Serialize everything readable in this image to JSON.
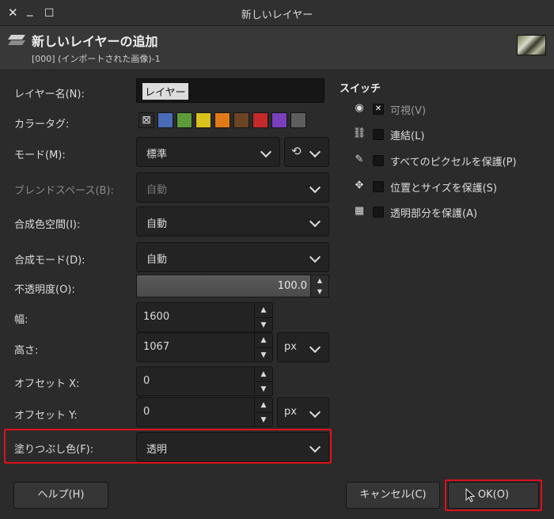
{
  "window": {
    "title": "新しいレイヤー",
    "close_glyph": "✕",
    "minimize_glyph": "_",
    "maximize_glyph": "□"
  },
  "header": {
    "title": "新しいレイヤーの追加",
    "subtitle": "[000] (インポートされた画像)-1",
    "icon": "new-layer-icon",
    "thumbnail": "image-thumbnail"
  },
  "form": {
    "layer_name": {
      "label": "レイヤー名(N):",
      "value": "レイヤー"
    },
    "color_tag": {
      "label": "カラータグ:",
      "none_glyph": "⊠",
      "colors": [
        "#4a6bb5",
        "#5d9a3a",
        "#d8c21c",
        "#e07a18",
        "#6b4424",
        "#c52a2a",
        "#7a3fbd",
        "#5e5e5e"
      ]
    },
    "mode": {
      "label": "モード(M):",
      "value": "標準",
      "switch_glyph": "⟲"
    },
    "blend_space": {
      "label": "ブレンドスペース(B):",
      "value": "自動",
      "disabled": true
    },
    "composite_space": {
      "label": "合成色空間(I):",
      "value": "自動"
    },
    "composite_mode": {
      "label": "合成モード(D):",
      "value": "自動"
    },
    "opacity": {
      "label": "不透明度(O):",
      "value": "100.0",
      "fraction": 1.0
    },
    "width": {
      "label": "幅:",
      "value": "1600"
    },
    "height": {
      "label": "高さ:",
      "value": "1067",
      "unit": "px"
    },
    "offset_x": {
      "label": "オフセット X:",
      "value": "0"
    },
    "offset_y": {
      "label": "オフセット Y:",
      "value": "0",
      "unit": "px"
    },
    "fill": {
      "label": "塗りつぶし色(F):",
      "value": "透明"
    }
  },
  "switches": {
    "title": "スイッチ",
    "items": [
      {
        "label": "可視(V)",
        "icon": "eye-icon",
        "glyph": "◉",
        "checked": true,
        "disabled": true
      },
      {
        "label": "連結(L)",
        "icon": "chain-icon",
        "glyph": "⛓",
        "checked": false
      },
      {
        "label": "すべてのピクセルを保護(P)",
        "icon": "paintbrush-icon",
        "glyph": "✎",
        "checked": false
      },
      {
        "label": "位置とサイズを保護(S)",
        "icon": "move-icon",
        "glyph": "✥",
        "checked": false
      },
      {
        "label": "透明部分を保護(A)",
        "icon": "checkerboard-icon",
        "glyph": "▦",
        "checked": false
      }
    ]
  },
  "buttons": {
    "help": "ヘルプ(H)",
    "cancel": "キャンセル(C)",
    "ok": "OK(O)"
  },
  "highlight_color": "#e0101a"
}
